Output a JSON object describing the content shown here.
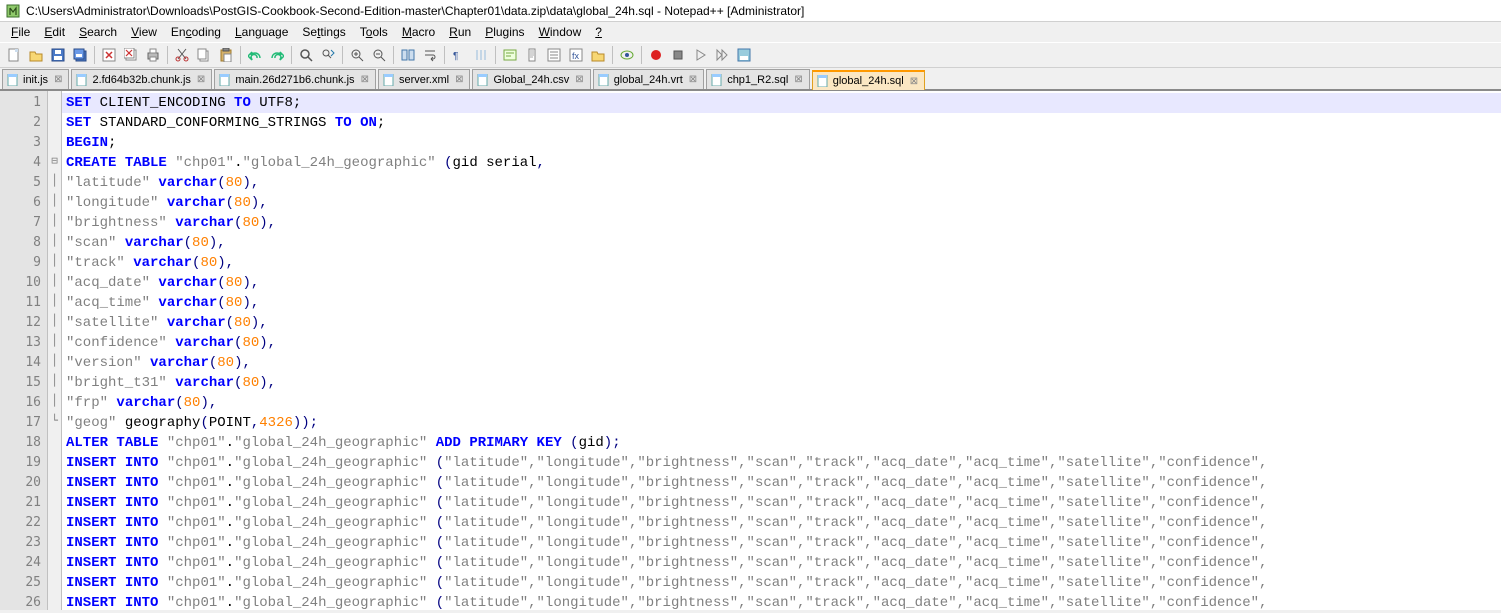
{
  "window": {
    "title": "C:\\Users\\Administrator\\Downloads\\PostGIS-Cookbook-Second-Edition-master\\Chapter01\\data.zip\\data\\global_24h.sql - Notepad++ [Administrator]"
  },
  "menu": {
    "file": "File",
    "edit": "Edit",
    "search": "Search",
    "view": "View",
    "encoding": "Encoding",
    "language": "Language",
    "settings": "Settings",
    "tools": "Tools",
    "macro": "Macro",
    "run": "Run",
    "plugins": "Plugins",
    "window": "Window",
    "help": "?"
  },
  "tabs": {
    "items": [
      {
        "label": "init.js",
        "active": false
      },
      {
        "label": "2.fd64b32b.chunk.js",
        "active": false
      },
      {
        "label": "main.26d271b6.chunk.js",
        "active": false
      },
      {
        "label": "server.xml",
        "active": false
      },
      {
        "label": "Global_24h.csv",
        "active": false
      },
      {
        "label": "global_24h.vrt",
        "active": false
      },
      {
        "label": "chp1_R2.sql",
        "active": false
      },
      {
        "label": "global_24h.sql",
        "active": true
      }
    ]
  },
  "code": {
    "line1": {
      "a": "SET",
      "b": " CLIENT_ENCODING ",
      "c": "TO",
      "d": " UTF8;"
    },
    "line2": {
      "a": "SET",
      "b": " STANDARD_CONFORMING_STRINGS ",
      "c": "TO",
      "d": " ",
      "e": "ON",
      "f": ";"
    },
    "line3": {
      "a": "BEGIN",
      "b": ";"
    },
    "line4": {
      "a": "CREATE",
      "b": " ",
      "c": "TABLE",
      "d": " ",
      "e": "\"chp01\"",
      "f": ".",
      "g": "\"global_24h_geographic\"",
      "h": " (",
      "i": "gid serial",
      "j": ","
    },
    "cols": [
      {
        "name": "\"latitude\"",
        "type": "varchar",
        "n": "80"
      },
      {
        "name": "\"longitude\"",
        "type": "varchar",
        "n": "80"
      },
      {
        "name": "\"brightness\"",
        "type": "varchar",
        "n": "80"
      },
      {
        "name": "\"scan\"",
        "type": "varchar",
        "n": "80"
      },
      {
        "name": "\"track\"",
        "type": "varchar",
        "n": "80"
      },
      {
        "name": "\"acq_date\"",
        "type": "varchar",
        "n": "80"
      },
      {
        "name": "\"acq_time\"",
        "type": "varchar",
        "n": "80"
      },
      {
        "name": "\"satellite\"",
        "type": "varchar",
        "n": "80"
      },
      {
        "name": "\"confidence\"",
        "type": "varchar",
        "n": "80"
      },
      {
        "name": "\"version\"",
        "type": "varchar",
        "n": "80"
      },
      {
        "name": "\"bright_t31\"",
        "type": "varchar",
        "n": "80"
      },
      {
        "name": "\"frp\"",
        "type": "varchar",
        "n": "80"
      }
    ],
    "line17": {
      "a": "\"geog\"",
      "b": " geography",
      "c": "(",
      "d": "POINT",
      "e": ",",
      "f": "4326",
      "g": "));"
    },
    "line18": {
      "a": "ALTER",
      "b": " ",
      "c": "TABLE",
      "d": " ",
      "e": "\"chp01\"",
      "f": ".",
      "g": "\"global_24h_geographic\"",
      "h": " ",
      "i": "ADD",
      "j": " ",
      "k": "PRIMARY",
      "l": " ",
      "m": "KEY",
      "n": " (",
      "o": "gid",
      "p": ");"
    },
    "insert": {
      "a": "INSERT",
      "b": " ",
      "c": "INTO",
      "d": " ",
      "e": "\"chp01\"",
      "f": ".",
      "g": "\"global_24h_geographic\"",
      "h": " (",
      "cols": "\"latitude\",\"longitude\",\"brightness\",\"scan\",\"track\",\"acq_date\",\"acq_time\",\"satellite\",\"confidence\","
    }
  },
  "line_numbers": [
    1,
    2,
    3,
    4,
    5,
    6,
    7,
    8,
    9,
    10,
    11,
    12,
    13,
    14,
    15,
    16,
    17,
    18,
    19,
    20,
    21,
    22,
    23,
    24,
    25,
    26
  ]
}
